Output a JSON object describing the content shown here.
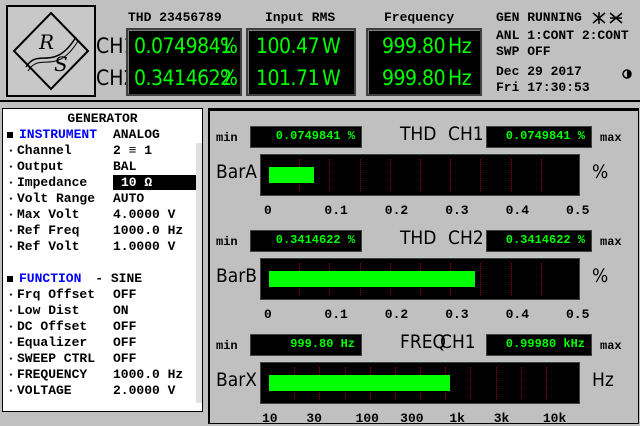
{
  "header": {
    "thd_title": "THD 23456789",
    "rms_title": "Input RMS",
    "freq_title": "Frequency",
    "ch1_label": "CH1",
    "ch2_label": "CH2",
    "ch1": {
      "thd": "0.0749841",
      "thd_unit": "%",
      "rms": "100.47",
      "rms_unit": "W",
      "freq": "999.80",
      "freq_unit": "Hz"
    },
    "ch2": {
      "thd": "0.3414622",
      "thd_unit": "%",
      "rms": "101.71",
      "rms_unit": "W",
      "freq": "999.80",
      "freq_unit": "Hz"
    },
    "status_line1": "GEN RUNNING",
    "status_line2": "ANL 1:CONT 2:CONT",
    "status_line3": "SWP OFF",
    "date": "Dec 29 2017",
    "time": "Fri  17:30:53"
  },
  "generator": {
    "title": "GENERATOR",
    "instrument_label": "INSTRUMENT",
    "instrument_value": "ANALOG",
    "rows1": [
      {
        "label": "Channel",
        "value": "2 ≡ 1"
      },
      {
        "label": "Output",
        "value": "BAL"
      },
      {
        "label": "Impedance",
        "value": "10 Ω"
      },
      {
        "label": "Volt Range",
        "value": "AUTO"
      },
      {
        "label": "Max Volt",
        "value": "4.0000 V"
      },
      {
        "label": "Ref Freq",
        "value": "1000.0 Hz"
      },
      {
        "label": "Ref Volt",
        "value": "1.0000 V"
      }
    ],
    "function_label": "FUNCTION",
    "function_value": "- SINE",
    "rows2": [
      {
        "label": "Frq Offset",
        "value": "OFF"
      },
      {
        "label": "Low Dist",
        "value": "ON"
      },
      {
        "label": "DC Offset",
        "value": "OFF"
      },
      {
        "label": "Equalizer",
        "value": "OFF"
      },
      {
        "label": "SWEEP CTRL",
        "value": "OFF"
      },
      {
        "label": "FREQUENCY",
        "value": "1000.0 Hz"
      },
      {
        "label": "VOLTAGE",
        "value": "2.0000 V"
      }
    ]
  },
  "bars": {
    "min_label": "min",
    "max_label": "max",
    "barA": {
      "title1": "THD",
      "title2": "CH1",
      "name": "BarA",
      "unit": "%",
      "min_value": "0.0749841 %",
      "max_value": "0.0749841 %",
      "fill_fraction": 0.15,
      "ticks": [
        "0",
        "0.1",
        "0.2",
        "0.3",
        "0.4",
        "0.5"
      ]
    },
    "barB": {
      "title1": "THD",
      "title2": "CH2",
      "name": "BarB",
      "unit": "%",
      "min_value": "0.3414622 %",
      "max_value": "0.3414622 %",
      "fill_fraction": 0.683,
      "ticks": [
        "0",
        "0.1",
        "0.2",
        "0.3",
        "0.4",
        "0.5"
      ]
    },
    "barX": {
      "title1": "FREQ",
      "title2": "CH1",
      "name": "BarX",
      "unit": "Hz",
      "min_value": "999.80  Hz",
      "max_value": "0.99980 kHz",
      "fill_fraction": 0.6,
      "ticks": [
        "10",
        "30",
        "100",
        "300",
        "1k",
        "3k",
        "10k"
      ]
    }
  },
  "colors": {
    "lcd_text": "#00ff00",
    "lcd_bg": "#000000",
    "panel": "#c0c0c0",
    "accent_blue": "#0000ff",
    "grid_red": "#a00000"
  },
  "icons": [
    "rohde-schwarz-logo",
    "generator-running-icon",
    "analyzer-running-icon",
    "brightness-icon"
  ]
}
